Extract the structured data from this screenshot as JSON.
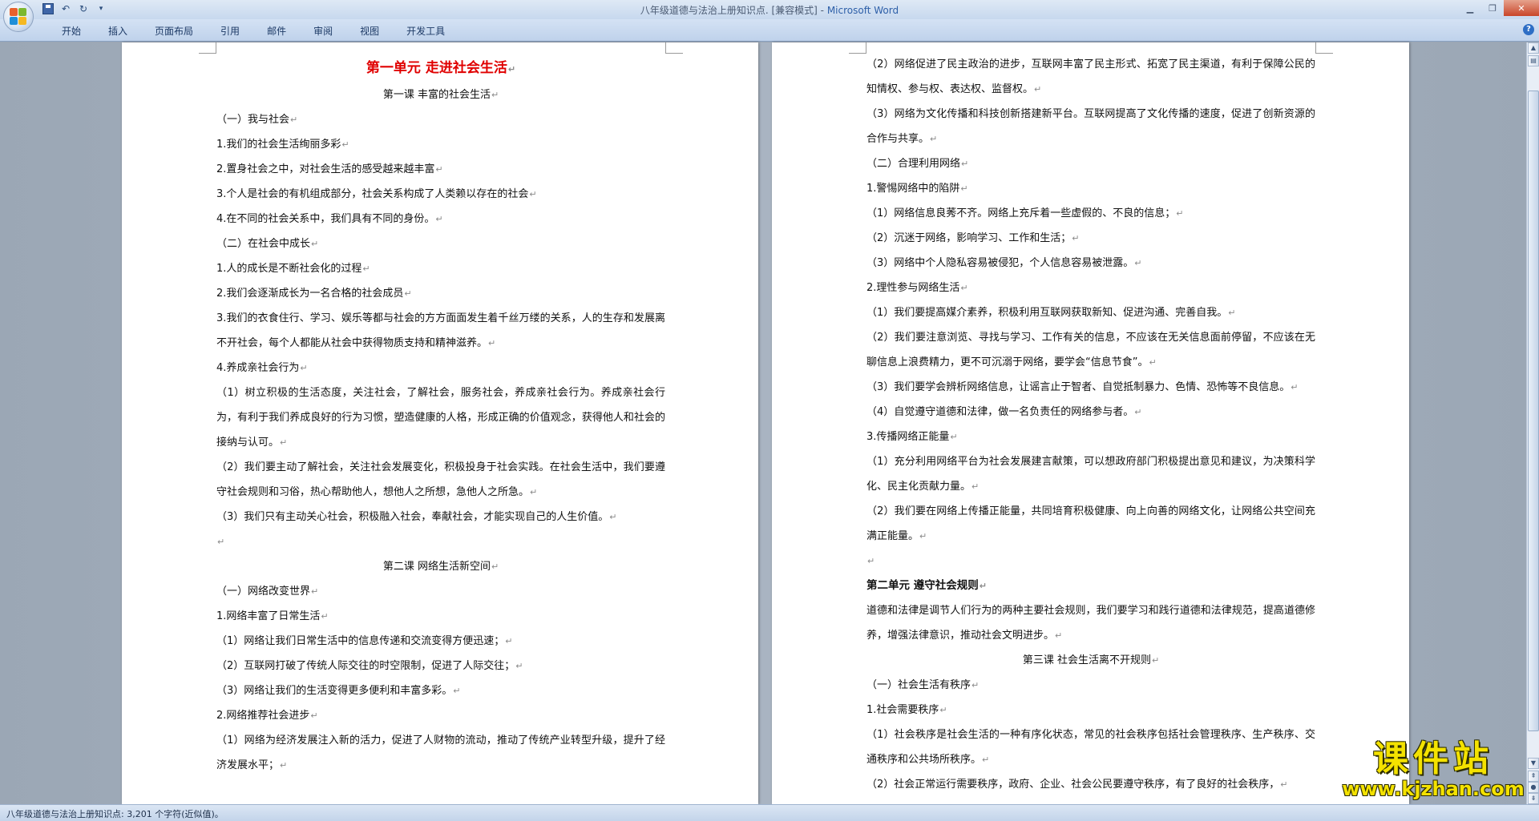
{
  "window": {
    "title": "八年级道德与法治上册知识点. [兼容模式] - ",
    "app_name": "Microsoft Word"
  },
  "ribbon": {
    "tabs": [
      "开始",
      "插入",
      "页面布局",
      "引用",
      "邮件",
      "审阅",
      "视图",
      "开发工具"
    ]
  },
  "page_left": {
    "lines": [
      "第一单元  走进社会生活",
      "第一课  丰富的社会生活",
      "（一）我与社会",
      "1.我们的社会生活绚丽多彩",
      "2.置身社会之中，对社会生活的感受越来越丰富",
      "3.个人是社会的有机组成部分，社会关系构成了人类赖以存在的社会",
      "4.在不同的社会关系中，我们具有不同的身份。",
      "（二）在社会中成长",
      "1.人的成长是不断社会化的过程",
      "2.我们会逐渐成长为一名合格的社会成员",
      "3.我们的衣食住行、学习、娱乐等都与社会的方方面面发生着千丝万缕的关系，人的生存和发展离不开社会，每个人都能从社会中获得物质支持和精神滋养。",
      "4.养成亲社会行为",
      "（1）树立积极的生活态度，关注社会，了解社会，服务社会，养成亲社会行为。养成亲社会行为，有利于我们养成良好的行为习惯，塑造健康的人格，形成正确的价值观念，获得他人和社会的接纳与认可。",
      "（2）我们要主动了解社会，关注社会发展变化，积极投身于社会实践。在社会生活中，我们要遵守社会规则和习俗，热心帮助他人，想他人之所想，急他人之所急。",
      "（3）我们只有主动关心社会，积极融入社会，奉献社会，才能实现自己的人生价值。",
      "",
      "第二课  网络生活新空间",
      "（一）网络改变世界",
      "1.网络丰富了日常生活",
      "（1）网络让我们日常生活中的信息传递和交流变得方便迅速；",
      "（2）互联网打破了传统人际交往的时空限制，促进了人际交往；",
      "（3）网络让我们的生活变得更多便利和丰富多彩。",
      "2.网络推荐社会进步",
      "（1）网络为经济发展注入新的活力，促进了人财物的流动，推动了传统产业转型升级，提升了经济发展水平；"
    ]
  },
  "page_right": {
    "lines": [
      "（2）网络促进了民主政治的进步，互联网丰富了民主形式、拓宽了民主渠道，有利于保障公民的知情权、参与权、表达权、监督权。",
      "（3）网络为文化传播和科技创新搭建新平台。互联网提高了文化传播的速度，促进了创新资源的合作与共享。",
      "（二）合理利用网络",
      "1.警惕网络中的陷阱",
      "（1）网络信息良莠不齐。网络上充斥着一些虚假的、不良的信息；",
      "（2）沉迷于网络，影响学习、工作和生活；",
      "（3）网络中个人隐私容易被侵犯，个人信息容易被泄露。",
      "2.理性参与网络生活",
      "（1）我们要提高媒介素养，积极利用互联网获取新知、促进沟通、完善自我。",
      "（2）我们要注意浏览、寻找与学习、工作有关的信息，不应该在无关信息面前停留，不应该在无聊信息上浪费精力，更不可沉溺于网络，要学会“信息节食”。",
      "（3）我们要学会辨析网络信息，让谣言止于智者、自觉抵制暴力、色情、恐怖等不良信息。",
      "（4）自觉遵守道德和法律，做一名负责任的网络参与者。",
      "3.传播网络正能量",
      "（1）充分利用网络平台为社会发展建言献策，可以想政府部门积极提出意见和建议，为决策科学化、民主化贡献力量。",
      "（2）我们要在网络上传播正能量，共同培育积极健康、向上向善的网络文化，让网络公共空间充满正能量。",
      "",
      "第二单元 遵守社会规则",
      "道德和法律是调节人们行为的两种主要社会规则，我们要学习和践行道德和法律规范，提高道德修养，增强法律意识，推动社会文明进步。",
      "第三课  社会生活离不开规则",
      "（一）社会生活有秩序",
      "1.社会需要秩序",
      "（1）社会秩序是社会生活的一种有序化状态，常见的社会秩序包括社会管理秩序、生产秩序、交通秩序和公共场所秩序。",
      "（2）社会正常运行需要秩序，政府、企业、社会公民要遵守秩序，有了良好的社会秩序，"
    ]
  },
  "statusbar": {
    "text": "八年级道德与法治上册知识点: 3,201 个字符(近似值)。"
  },
  "watermark": {
    "title": "课件站",
    "url": "www.kjzhan.com"
  },
  "colors": {
    "title_red": "#e00000",
    "watermark_yellow": "#f4e200"
  }
}
